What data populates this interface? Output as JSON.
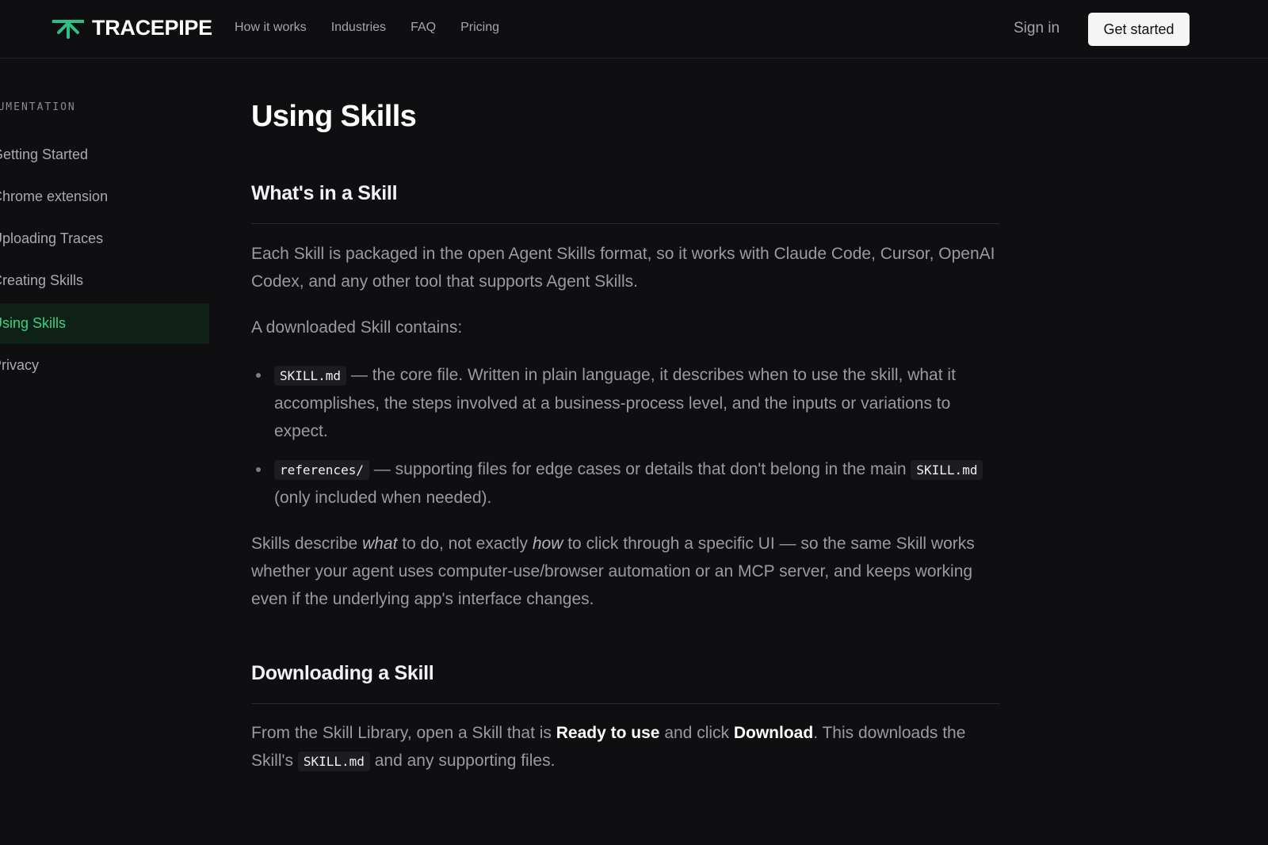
{
  "header": {
    "brand": "TRACEPIPE",
    "nav": [
      "How it works",
      "Industries",
      "FAQ",
      "Pricing"
    ],
    "sign_in": "Sign in",
    "cta": "Get started",
    "accent": "#2fbf86"
  },
  "sidebar": {
    "label": "DOCUMENTATION",
    "items": [
      {
        "label": "Getting Started",
        "active": false
      },
      {
        "label": "Chrome extension",
        "active": false
      },
      {
        "label": "Uploading Traces",
        "active": false
      },
      {
        "label": "Creating Skills",
        "active": false
      },
      {
        "label": "Using Skills",
        "active": true
      },
      {
        "label": "Privacy",
        "active": false
      }
    ],
    "active_color": "#3bd081"
  },
  "main": {
    "title": "Using Skills",
    "sections": [
      {
        "heading": "What's in a Skill",
        "intro": "Each Skill is packaged in the open Agent Skills format, so it works with Claude Code, Cursor, OpenAI Codex, and any other tool that supports Agent Skills.",
        "contains_label": "A downloaded Skill contains:",
        "bullets": [
          {
            "code": "SKILL.md",
            "text": " — the core file. Written in plain language, it describes when to use the skill, what it accomplishes, the steps involved at a business-process level, and the inputs or variations to expect."
          },
          {
            "code": "references/",
            "text": " — supporting files for edge cases or details that don't belong in the main ",
            "code2": "SKILL.md",
            "text2": " (only included when needed)."
          }
        ],
        "closing": {
          "p1": "Skills describe ",
          "em1": "what",
          "p2": " to do, not exactly ",
          "em2": "how",
          "p3": " to click through a specific UI — so the same Skill works whether your agent uses computer-use/browser automation or an MCP server, and keeps working even if the underlying app's interface changes."
        }
      },
      {
        "heading": "Downloading a Skill",
        "p1": "From the Skill Library, open a Skill that is ",
        "strong1": "Ready to use",
        "p2": " and click ",
        "strong2": "Download",
        "p3": ". This downloads the Skill's ",
        "code": "SKILL.md",
        "p4": " and any supporting files."
      }
    ]
  }
}
